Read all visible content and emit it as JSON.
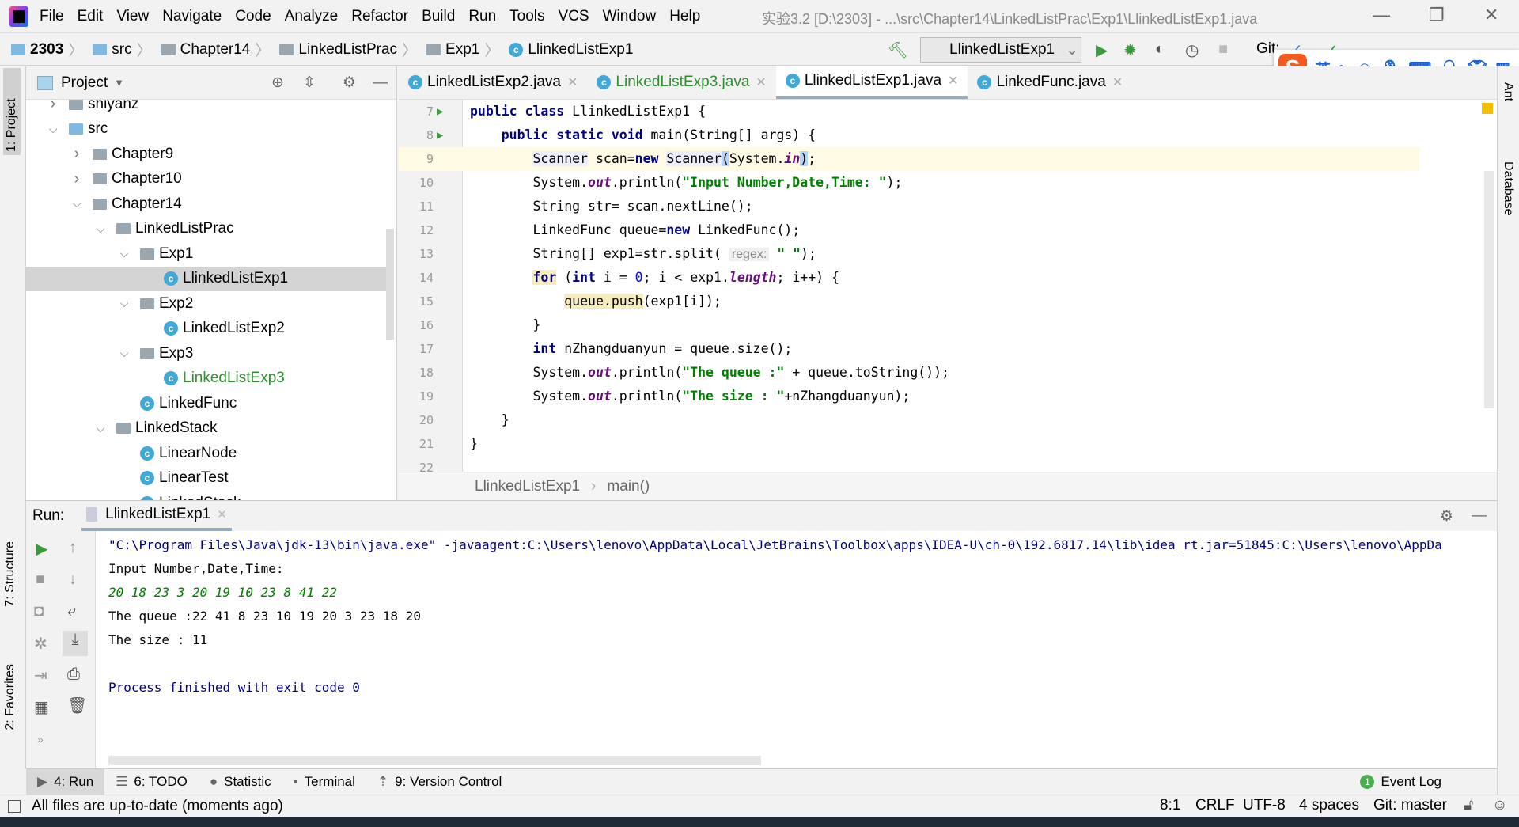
{
  "window": {
    "title": "实验3.2 [D:\\2303] - ...\\src\\Chapter14\\LinkedListPrac\\Exp1\\LlinkedListExp1.java"
  },
  "menu": [
    "File",
    "Edit",
    "View",
    "Navigate",
    "Code",
    "Analyze",
    "Refactor",
    "Build",
    "Run",
    "Tools",
    "VCS",
    "Window",
    "Help"
  ],
  "breadcrumb": [
    "2303",
    "src",
    "Chapter14",
    "LinkedListPrac",
    "Exp1",
    "LlinkedListExp1"
  ],
  "toolbar": {
    "run_config": "LlinkedListExp1",
    "git_label": "Git:"
  },
  "ime": {
    "logo": "S",
    "lang": "英"
  },
  "project": {
    "title": "Project",
    "tree": [
      {
        "label": "shiyanz",
        "level": 1,
        "type": "folder",
        "arrow": ">"
      },
      {
        "label": "src",
        "level": 1,
        "type": "folder",
        "arrow": "v"
      },
      {
        "label": "Chapter9",
        "level": 2,
        "type": "folder",
        "arrow": ">"
      },
      {
        "label": "Chapter10",
        "level": 2,
        "type": "folder",
        "arrow": ">"
      },
      {
        "label": "Chapter14",
        "level": 2,
        "type": "folder",
        "arrow": "v"
      },
      {
        "label": "LinkedListPrac",
        "level": 3,
        "type": "folder",
        "arrow": "v"
      },
      {
        "label": "Exp1",
        "level": 4,
        "type": "folder",
        "arrow": "v"
      },
      {
        "label": "LlinkedListExp1",
        "level": 5,
        "type": "main",
        "selected": true
      },
      {
        "label": "Exp2",
        "level": 4,
        "type": "folder",
        "arrow": "v"
      },
      {
        "label": "LinkedListExp2",
        "level": 5,
        "type": "main"
      },
      {
        "label": "Exp3",
        "level": 4,
        "type": "folder",
        "arrow": "v"
      },
      {
        "label": "LinkedListExp3",
        "level": 5,
        "type": "main",
        "green": true
      },
      {
        "label": "LinkedFunc",
        "level": 4,
        "type": "class"
      },
      {
        "label": "LinkedStack",
        "level": 3,
        "type": "folder",
        "arrow": "v"
      },
      {
        "label": "LinearNode",
        "level": 4,
        "type": "class"
      },
      {
        "label": "LinearTest",
        "level": 4,
        "type": "main"
      },
      {
        "label": "LinkedStack",
        "level": 4,
        "type": "class"
      }
    ]
  },
  "tabs": [
    {
      "label": "LinkedListExp2.java"
    },
    {
      "label": "LinkedListExp3.java",
      "green": true
    },
    {
      "label": "LlinkedListExp1.java",
      "active": true
    },
    {
      "label": "LinkedFunc.java"
    }
  ],
  "code": [
    {
      "n": "7",
      "run": true,
      "t": [
        [
          "public class ",
          "kw"
        ],
        [
          "LlinkedListExp1 {",
          ""
        ]
      ]
    },
    {
      "n": "8",
      "run": true,
      "t": [
        [
          "    ",
          ""
        ],
        [
          "public static void ",
          "kw"
        ],
        [
          "main(String[] args) {",
          ""
        ]
      ]
    },
    {
      "n": "9",
      "cur": true,
      "t": [
        [
          "        ",
          ""
        ],
        [
          "Scanner",
          "hl"
        ],
        [
          " scan=",
          ""
        ],
        [
          "new ",
          "kw"
        ],
        [
          "Scanner",
          "hl"
        ],
        [
          "(",
          "br"
        ],
        [
          "System.",
          ""
        ],
        [
          "in",
          "fi"
        ],
        [
          ")",
          "br"
        ],
        [
          ";",
          ""
        ]
      ]
    },
    {
      "n": "10",
      "t": [
        [
          "        System.",
          ""
        ],
        [
          "out",
          "fi"
        ],
        [
          ".println(",
          ""
        ],
        [
          "\"Input Number,Date,Time: \"",
          "st"
        ],
        [
          ");",
          ""
        ]
      ]
    },
    {
      "n": "11",
      "t": [
        [
          "        String str= scan.nextLine();",
          ""
        ]
      ]
    },
    {
      "n": "12",
      "t": [
        [
          "        LinkedFunc queue=",
          ""
        ],
        [
          "new ",
          "kw"
        ],
        [
          "LinkedFunc();",
          ""
        ]
      ]
    },
    {
      "n": "13",
      "t": [
        [
          "        String[] exp1=str.split( ",
          ""
        ],
        [
          "regex:",
          "hint"
        ],
        [
          " ",
          ""
        ],
        [
          "\" \"",
          "st"
        ],
        [
          ");",
          ""
        ]
      ]
    },
    {
      "n": "14",
      "t": [
        [
          "        ",
          ""
        ],
        [
          "for",
          "kw hy"
        ],
        [
          " (",
          ""
        ],
        [
          "int ",
          "kw"
        ],
        [
          "i = ",
          ""
        ],
        [
          "0",
          "num"
        ],
        [
          "; i < exp1.",
          ""
        ],
        [
          "length",
          "fi"
        ],
        [
          "; i++) {",
          ""
        ]
      ]
    },
    {
      "n": "15",
      "t": [
        [
          "            ",
          ""
        ],
        [
          "queue.push",
          "hy"
        ],
        [
          "(exp1[i]);",
          ""
        ]
      ]
    },
    {
      "n": "16",
      "t": [
        [
          "        }",
          ""
        ]
      ]
    },
    {
      "n": "17",
      "t": [
        [
          "        ",
          ""
        ],
        [
          "int ",
          "kw"
        ],
        [
          "nZhangduanyun = queue.size();",
          ""
        ]
      ]
    },
    {
      "n": "18",
      "t": [
        [
          "        System.",
          ""
        ],
        [
          "out",
          "fi"
        ],
        [
          ".println(",
          ""
        ],
        [
          "\"The queue :\"",
          "st"
        ],
        [
          " + queue.toString());",
          ""
        ]
      ]
    },
    {
      "n": "19",
      "t": [
        [
          "        System.",
          ""
        ],
        [
          "out",
          "fi"
        ],
        [
          ".println(",
          ""
        ],
        [
          "\"The size : \"",
          "st"
        ],
        [
          "+nZhangduanyun);",
          ""
        ]
      ]
    },
    {
      "n": "20",
      "t": [
        [
          "    }",
          ""
        ]
      ]
    },
    {
      "n": "21",
      "t": [
        [
          "}",
          ""
        ]
      ]
    },
    {
      "n": "22",
      "t": []
    }
  ],
  "editor_breadcrumb": [
    "LlinkedListExp1",
    "main()"
  ],
  "run": {
    "label": "Run:",
    "tab": "LlinkedListExp1",
    "console": [
      {
        "text": "\"C:\\Program Files\\Java\\jdk-13\\bin\\java.exe\" -javaagent:C:\\Users\\lenovo\\AppData\\Local\\JetBrains\\Toolbox\\apps\\IDEA-U\\ch-0\\192.6817.14\\lib\\idea_rt.jar=51845:C:\\Users\\lenovo\\AppDa",
        "cls": "blue"
      },
      {
        "text": "Input Number,Date,Time:",
        "cls": ""
      },
      {
        "text": "20 18 23 3 20 19 10 23 8 41 22",
        "cls": "green-in"
      },
      {
        "text": "The queue :22 41 8 23 10 19 20 3 23 18 20",
        "cls": ""
      },
      {
        "text": "The size : 11",
        "cls": ""
      },
      {
        "text": "",
        "cls": ""
      },
      {
        "text": "Process finished with exit code 0",
        "cls": "blue"
      }
    ]
  },
  "side": {
    "project": "1: Project",
    "structure": "7: Structure",
    "favorites": "2: Favorites",
    "ant": "Ant",
    "database": "Database"
  },
  "bottom_tabs": [
    {
      "label": "4: Run",
      "active": true,
      "icon": "▶"
    },
    {
      "label": "6: TODO",
      "icon": "☰"
    },
    {
      "label": "Statistic",
      "icon": "●"
    },
    {
      "label": "Terminal",
      "icon": "▪"
    },
    {
      "label": "9: Version Control",
      "icon": "⇡"
    }
  ],
  "event_log": {
    "count": "1",
    "label": "Event Log"
  },
  "status": {
    "message": "All files are up-to-date (moments ago)",
    "position": "8:1",
    "line_sep": "CRLF",
    "encoding": "UTF-8",
    "indent": "4 spaces",
    "git": "Git: master"
  }
}
